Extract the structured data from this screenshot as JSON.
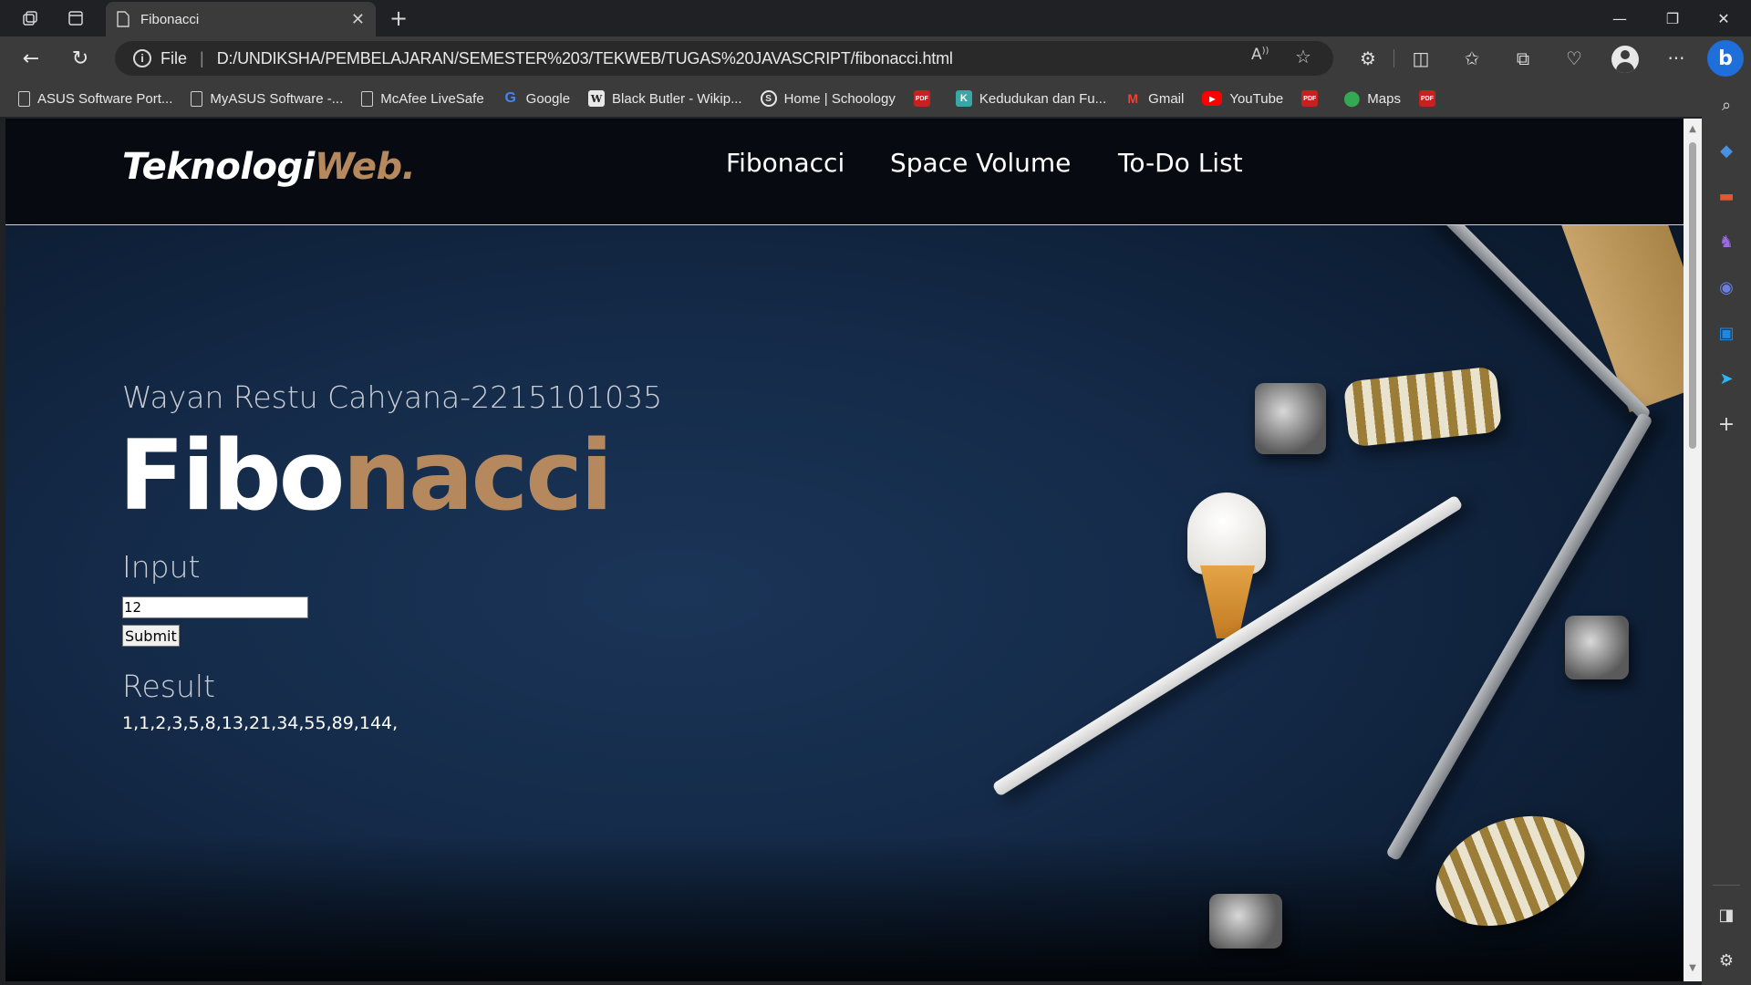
{
  "browser": {
    "tab_title": "Fibonacci",
    "address": {
      "scheme_label": "File",
      "url": "D:/UNDIKSHA/PEMBELAJARAN/SEMESTER%203/TEKWEB/TUGAS%20JAVASCRIPT/fibonacci.html"
    },
    "bookmarks": [
      {
        "label": "ASUS Software Port...",
        "icon": "page-icon"
      },
      {
        "label": "MyASUS Software -...",
        "icon": "page-icon"
      },
      {
        "label": "McAfee LiveSafe",
        "icon": "page-icon"
      },
      {
        "label": "Google",
        "icon": "google-icon"
      },
      {
        "label": "Black Butler - Wikip...",
        "icon": "wikipedia-icon"
      },
      {
        "label": "Home | Schoology",
        "icon": "schoology-icon"
      },
      {
        "label": "",
        "icon": "pdf-icon"
      },
      {
        "label": "Kedudukan dan Fu...",
        "icon": "kedudukan-icon"
      },
      {
        "label": "Gmail",
        "icon": "gmail-icon"
      },
      {
        "label": "YouTube",
        "icon": "youtube-icon"
      },
      {
        "label": "",
        "icon": "pdf-icon"
      },
      {
        "label": "Maps",
        "icon": "maps-icon"
      },
      {
        "label": "",
        "icon": "pdf-icon"
      }
    ]
  },
  "site": {
    "logo_main": "Teknologi",
    "logo_accent": "Web.",
    "nav": [
      "Fibonacci",
      "Space Volume",
      "To-Do List"
    ],
    "subtitle": "Wayan Restu Cahyana-2215101035",
    "title_main": "Fibo",
    "title_accent": "nacci",
    "input_label": "Input",
    "input_value": "12",
    "submit_label": "Submit",
    "result_label": "Result",
    "result_value": "1,1,2,3,5,8,13,21,34,55,89,144,"
  },
  "colors": {
    "accent": "#b5885e",
    "nav_background": "#070a10",
    "page_background": "#142a48"
  }
}
